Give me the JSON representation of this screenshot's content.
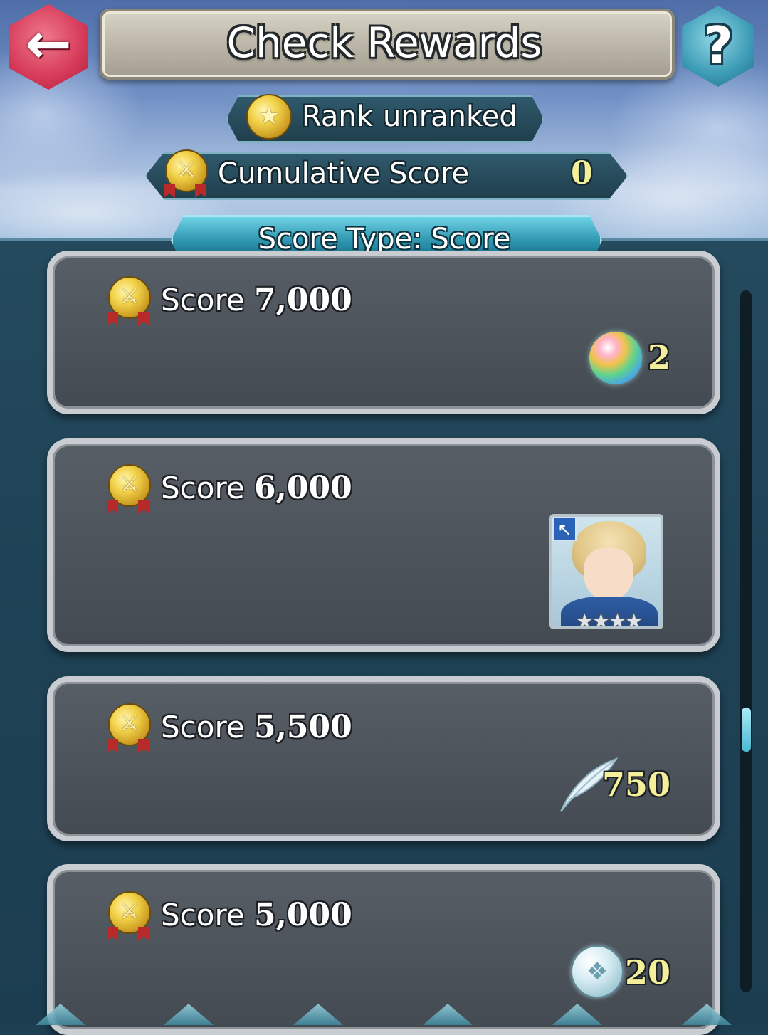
{
  "header": {
    "title": "Check Rewards",
    "back_icon": "back-arrow-icon",
    "help_label": "?"
  },
  "rank": {
    "label": "Rank",
    "value": "unranked"
  },
  "cumulative": {
    "label": "Cumulative Score",
    "value": "0"
  },
  "score_type": {
    "label": "Score Type: Score"
  },
  "rewards": [
    {
      "label": "Score",
      "score": "7,000",
      "reward_icon": "orb-icon",
      "quantity": "2"
    },
    {
      "label": "Score",
      "score": "6,000",
      "reward_icon": "hero-portrait",
      "stars": "★★★★"
    },
    {
      "label": "Score",
      "score": "5,500",
      "reward_icon": "feather-icon",
      "quantity": "750"
    },
    {
      "label": "Score",
      "score": "5,000",
      "reward_icon": "badge-coin-icon",
      "quantity": "20"
    }
  ],
  "colors": {
    "accent_value": "#f4ef9a",
    "back_button": "#d63a58",
    "help_button": "#3c9bb5",
    "card": "#4b525a"
  }
}
